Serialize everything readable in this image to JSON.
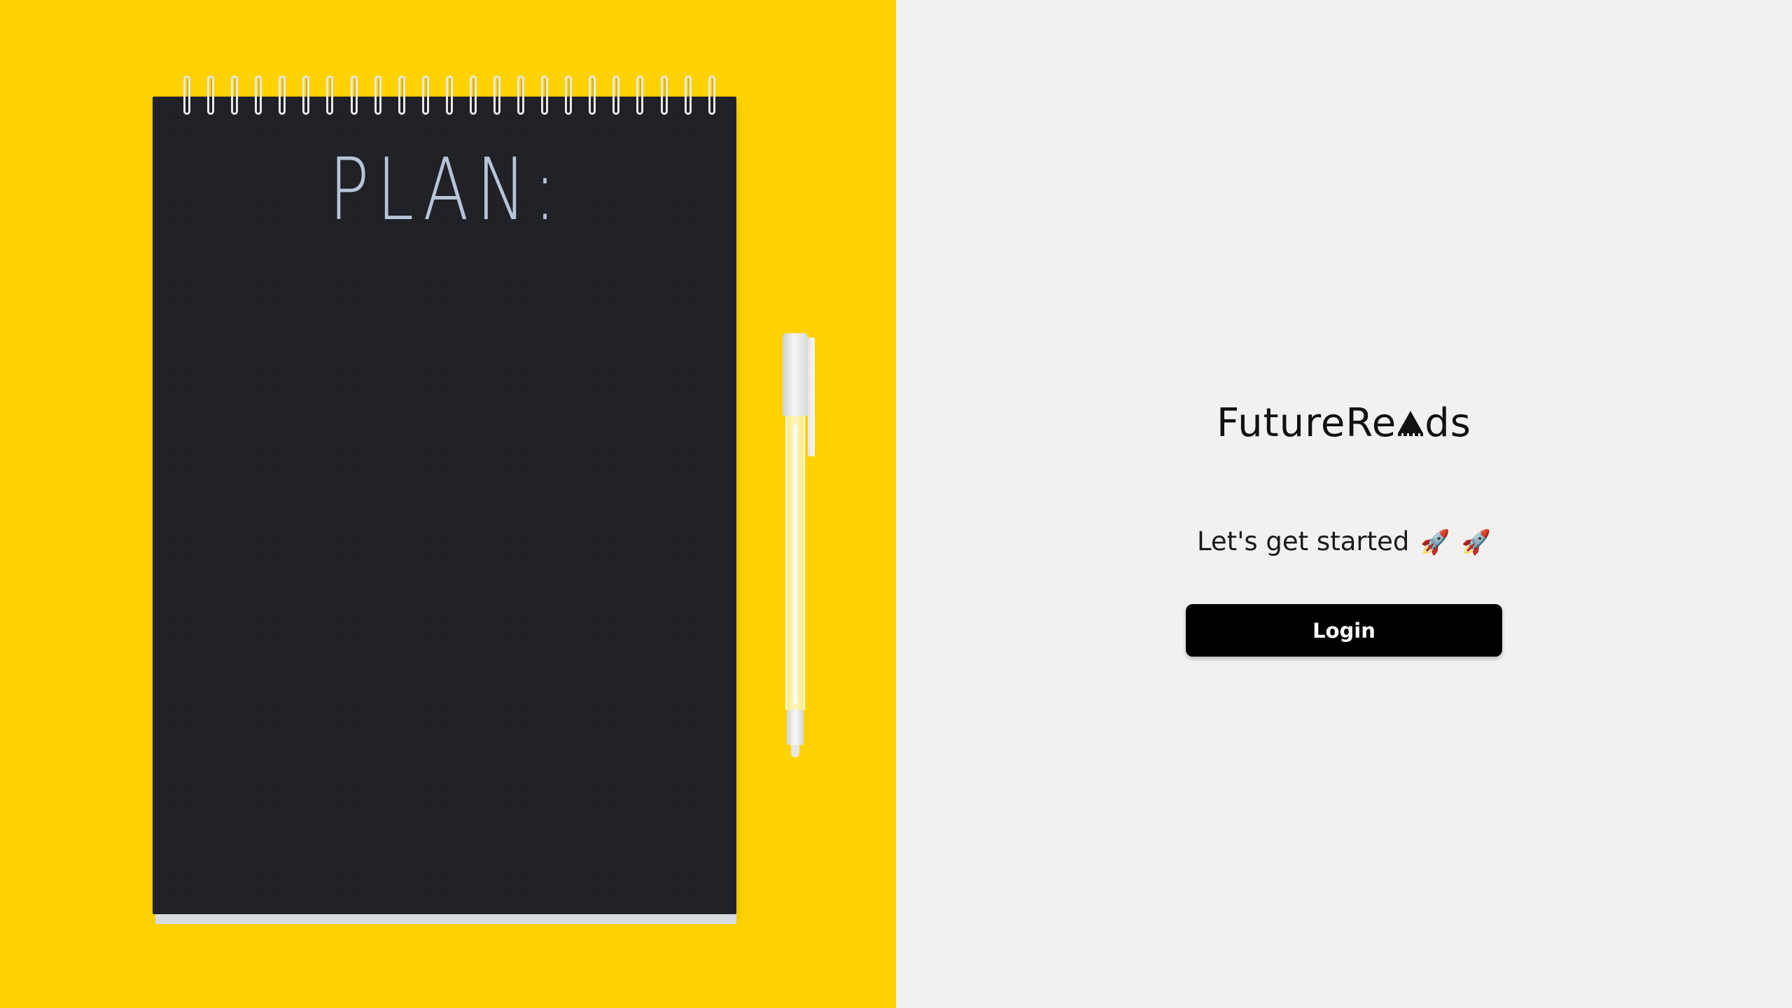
{
  "hero": {
    "notebook_heading": "PLAN:",
    "background_color": "#FFD200"
  },
  "brand": {
    "name_prefix": "FutureRe",
    "logo_glyph": "triangle-logo-icon",
    "name_suffix": "ds"
  },
  "tagline": {
    "text": "Let's get started",
    "rocket_1": "🚀",
    "rocket_2": "🚀"
  },
  "login": {
    "label": "Login"
  },
  "colors": {
    "panel_background": "#F2F1EF",
    "button_background": "#000000",
    "button_text": "#FFFFFF"
  }
}
